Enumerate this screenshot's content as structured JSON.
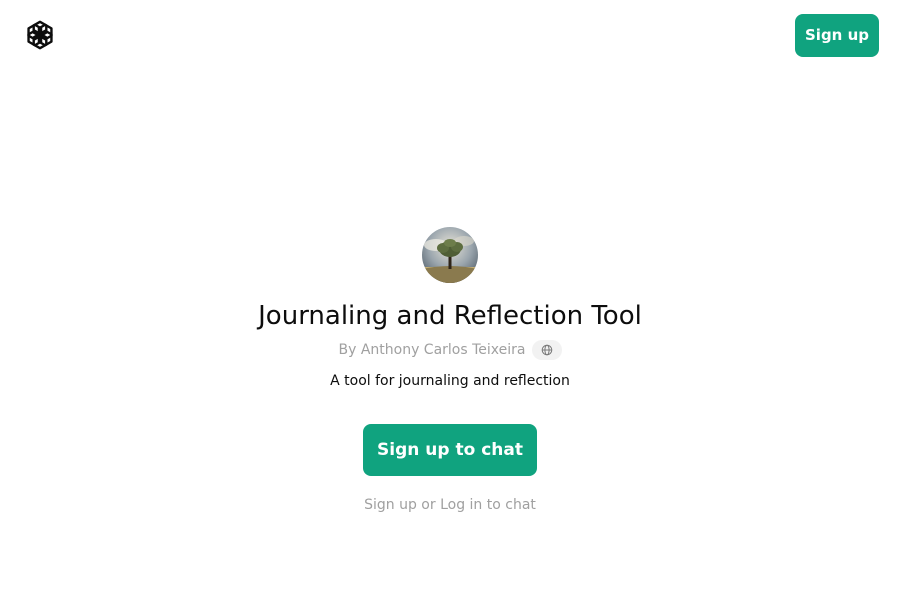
{
  "header": {
    "logo_icon": "openai-logo-icon",
    "signup_label": "Sign up"
  },
  "gpt": {
    "avatar_icon": "tree-avatar-image",
    "title": "Journaling and Reflection Tool",
    "byline": "By Anthony Carlos Teixeira",
    "byline_badge_icon": "globe-icon",
    "description": "A tool for journaling and reflection"
  },
  "actions": {
    "cta_label": "Sign up to chat",
    "footer_link": "Sign up or Log in to chat"
  },
  "colors": {
    "accent": "#10a37f",
    "muted_text": "#a0a0a0",
    "text": "#0d0d0d"
  }
}
